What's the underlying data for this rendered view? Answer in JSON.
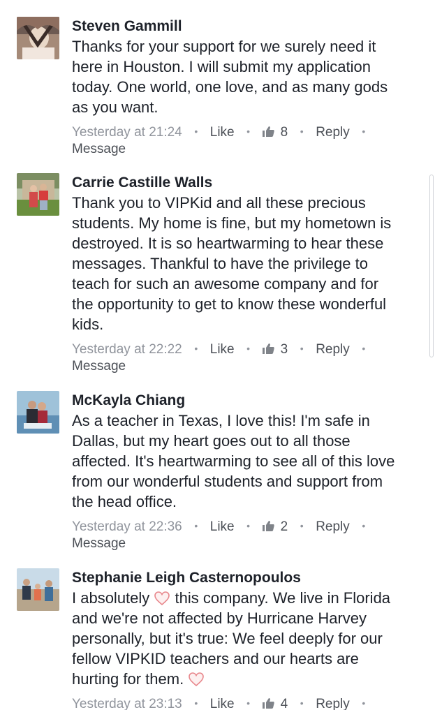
{
  "comments": [
    {
      "author": "Steven Gammill",
      "lines": [
        "Thanks for your support for we surely need it",
        "here in Houston. I will submit my application",
        "today. One world, one love, and as many gods",
        "as you want."
      ],
      "timestamp": "Yesterday at 21:24",
      "like_label": "Like",
      "like_count": "8",
      "reply_label": "Reply",
      "message_label": "Message"
    },
    {
      "author": "Carrie Castille Walls",
      "lines": [
        "Thank you to VIPKid and all these precious",
        "students.  My home is fine, but my hometown is",
        "destroyed.  It is so heartwarming to hear these",
        "messages.  Thankful to have the privilege to",
        "teach for such an awesome company and for",
        "the opportunity to get to know these wonderful",
        "kids."
      ],
      "timestamp": "Yesterday at 22:22",
      "like_label": "Like",
      "like_count": "3",
      "reply_label": "Reply",
      "message_label": "Message"
    },
    {
      "author": "McKayla Chiang",
      "lines": [
        "As a teacher in Texas, I love this! I'm safe in",
        "Dallas, but my heart goes out to all those",
        "affected. It's heartwarming to see all of this love",
        "from our wonderful students and support from",
        "the head office."
      ],
      "timestamp": "Yesterday at 22:36",
      "like_label": "Like",
      "like_count": "2",
      "reply_label": "Reply",
      "message_label": "Message"
    },
    {
      "author": "Stephanie Leigh Casternopoulos",
      "line1_before": "I absolutely ",
      "line1_after": " this company.  We live in Florida",
      "lines": [
        "and we're not affected by Hurricane Harvey",
        "personally, but it's true: We feel deeply for our",
        "fellow VIPKID teachers and our hearts are"
      ],
      "last_line": "hurting for them. ",
      "timestamp": "Yesterday at 23:13",
      "like_label": "Like",
      "like_count": "4",
      "reply_label": "Reply"
    }
  ],
  "icons": {
    "like": "thumbs-up-icon",
    "heart": "heart-emoji-icon"
  },
  "colors": {
    "meta_gray": "#90949c",
    "action_gray": "#4b4f56",
    "text": "#1d2129",
    "heart_stroke": "#e8878c"
  }
}
